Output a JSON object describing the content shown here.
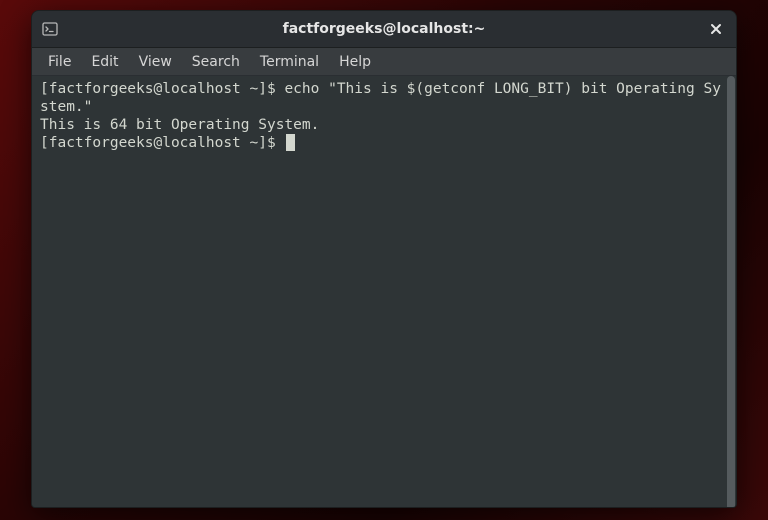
{
  "titlebar": {
    "title": "factforgeeks@localhost:~"
  },
  "menubar": {
    "items": [
      "File",
      "Edit",
      "View",
      "Search",
      "Terminal",
      "Help"
    ]
  },
  "terminal": {
    "lines": [
      {
        "prompt": "[factforgeeks@localhost ~]$ ",
        "cmd": "echo \"This is $(getconf LONG_BIT) bit Operating System.\""
      },
      {
        "text": "This is 64 bit Operating System."
      },
      {
        "prompt": "[factforgeeks@localhost ~]$ ",
        "cmd": "",
        "cursor": true
      }
    ]
  }
}
